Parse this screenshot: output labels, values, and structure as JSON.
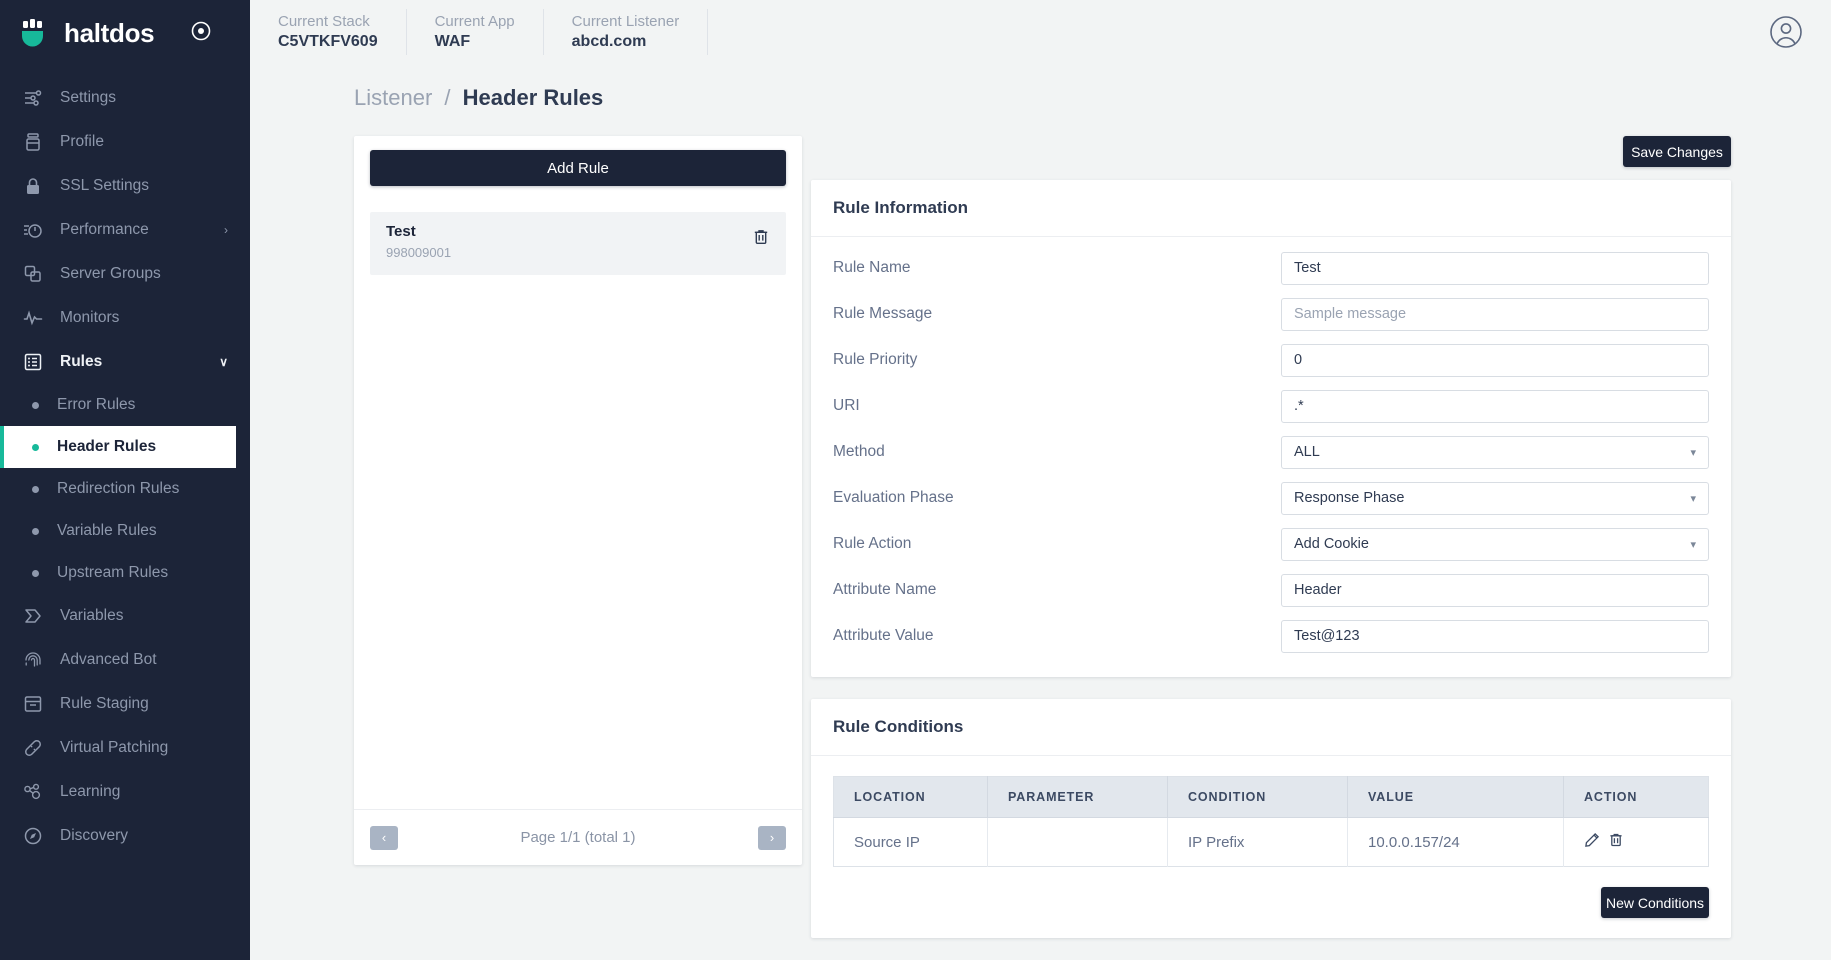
{
  "brand": {
    "name": "haltdos",
    "logo_icon": "haltdos-logo-icon",
    "target_icon": "target-icon"
  },
  "topbar": {
    "contexts": [
      {
        "label": "Current Stack",
        "value": "C5VTKFV609"
      },
      {
        "label": "Current App",
        "value": "WAF"
      },
      {
        "label": "Current Listener",
        "value": "abcd.com"
      }
    ],
    "avatar_icon": "user-avatar-icon"
  },
  "sidebar": {
    "items": [
      {
        "label": "Settings",
        "icon": "sliders-icon"
      },
      {
        "label": "Profile",
        "icon": "profile-box-icon"
      },
      {
        "label": "SSL Settings",
        "icon": "lock-icon"
      },
      {
        "label": "Performance",
        "icon": "speedometer-icon",
        "chevron": "›"
      },
      {
        "label": "Server Groups",
        "icon": "copy-layers-icon"
      },
      {
        "label": "Monitors",
        "icon": "pulse-icon"
      },
      {
        "label": "Rules",
        "icon": "list-box-icon",
        "chevron": "∨",
        "expanded": true
      }
    ],
    "sub_items": [
      {
        "label": "Error Rules",
        "active": false
      },
      {
        "label": "Header Rules",
        "active": true
      },
      {
        "label": "Redirection Rules",
        "active": false
      },
      {
        "label": "Variable Rules",
        "active": false
      },
      {
        "label": "Upstream Rules",
        "active": false
      }
    ],
    "items_after": [
      {
        "label": "Variables",
        "icon": "variable-tag-icon"
      },
      {
        "label": "Advanced Bot",
        "icon": "fingerprint-icon"
      },
      {
        "label": "Rule Staging",
        "icon": "archive-icon"
      },
      {
        "label": "Virtual Patching",
        "icon": "bandage-icon"
      },
      {
        "label": "Learning",
        "icon": "nodes-icon"
      },
      {
        "label": "Discovery",
        "icon": "discovery-icon"
      }
    ],
    "accent_color": "#17b99a",
    "background_color": "#1c2438"
  },
  "breadcrumb": {
    "parent": "Listener",
    "separator": "/",
    "current": "Header Rules"
  },
  "rule_list": {
    "add_button": "Add Rule",
    "rules": [
      {
        "name": "Test",
        "id": "998009001",
        "delete_icon": "trash-icon"
      }
    ],
    "pagination": {
      "prev": "‹",
      "next": "›",
      "text": "Page 1/1 (total 1)"
    }
  },
  "actions": {
    "save_changes": "Save Changes",
    "new_conditions": "New Conditions"
  },
  "rule_information": {
    "title": "Rule Information",
    "fields": [
      {
        "label": "Rule Name",
        "value": "Test",
        "type": "text",
        "placeholder": false
      },
      {
        "label": "Rule Message",
        "value": "Sample message",
        "type": "text",
        "placeholder": true
      },
      {
        "label": "Rule Priority",
        "value": "0",
        "type": "text",
        "placeholder": false
      },
      {
        "label": "URI",
        "value": ".*",
        "type": "text",
        "placeholder": false
      },
      {
        "label": "Method",
        "value": "ALL",
        "type": "select",
        "placeholder": false
      },
      {
        "label": "Evaluation Phase",
        "value": "Response Phase",
        "type": "select",
        "placeholder": false
      },
      {
        "label": "Rule Action",
        "value": "Add Cookie",
        "type": "select",
        "placeholder": false
      },
      {
        "label": "Attribute Name",
        "value": "Header",
        "type": "text",
        "placeholder": false
      },
      {
        "label": "Attribute Value",
        "value": "Test@123",
        "type": "text",
        "placeholder": false
      }
    ]
  },
  "rule_conditions": {
    "title": "Rule Conditions",
    "columns": [
      "LOCATION",
      "PARAMETER",
      "CONDITION",
      "VALUE",
      "ACTION"
    ],
    "rows": [
      {
        "location": "Source IP",
        "parameter": "",
        "condition": "IP Prefix",
        "value": "10.0.0.157/24",
        "edit_icon": "pencil-icon",
        "delete_icon": "trash-icon"
      }
    ]
  }
}
